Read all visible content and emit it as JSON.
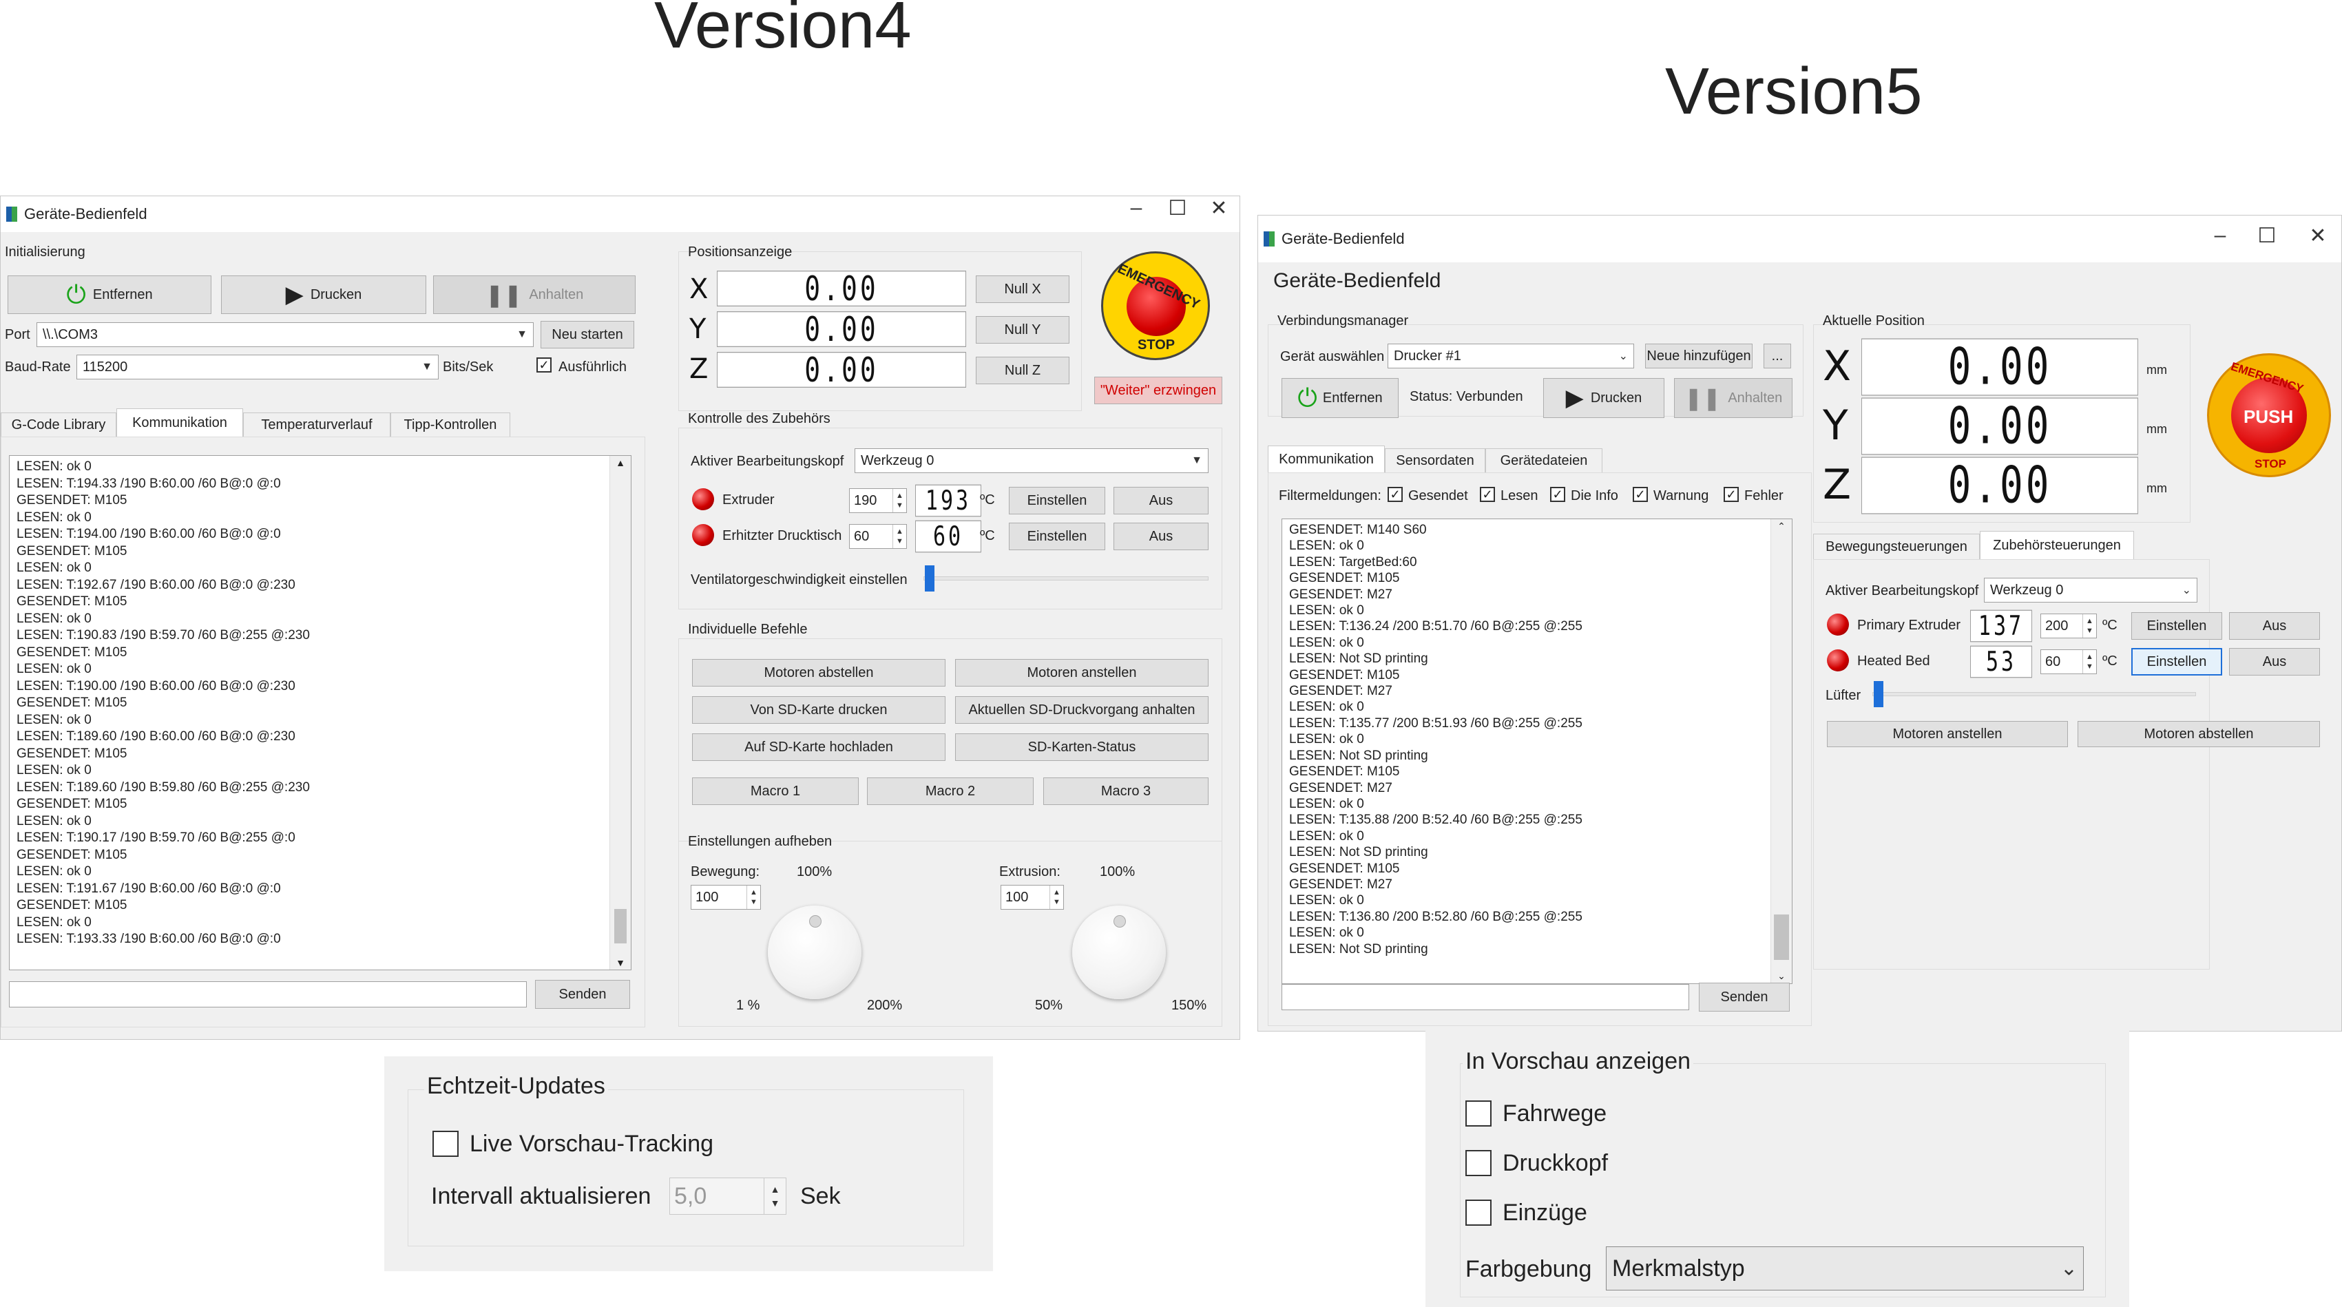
{
  "headings": {
    "v4": "Version4",
    "v5": "Version5"
  },
  "v4": {
    "title": "Geräte-Bedienfeld",
    "init": {
      "label": "Initialisierung",
      "btn_remove": "Entfernen",
      "btn_print": "Drucken",
      "btn_pause": "Anhalten",
      "port_label": "Port",
      "port_value": "\\\\.\\COM3",
      "btn_restart": "Neu starten",
      "baud_label": "Baud-Rate",
      "baud_value": "115200",
      "baud_unit": "Bits/Sek",
      "verbose": "Ausführlich"
    },
    "tabs": [
      "G-Code Library",
      "Kommunikation",
      "Temperaturverlauf",
      "Tipp-Kontrollen"
    ],
    "log": [
      "LESEN: ok 0",
      "LESEN: T:194.33 /190 B:60.00 /60 B@:0 @:0",
      "GESENDET: M105",
      "LESEN: ok 0",
      "LESEN: T:194.00 /190 B:60.00 /60 B@:0 @:0",
      "GESENDET: M105",
      "LESEN: ok 0",
      "LESEN: T:192.67 /190 B:60.00 /60 B@:0 @:230",
      "GESENDET: M105",
      "LESEN: ok 0",
      "LESEN: T:190.83 /190 B:59.70 /60 B@:255 @:230",
      "GESENDET: M105",
      "LESEN: ok 0",
      "LESEN: T:190.00 /190 B:60.00 /60 B@:0 @:230",
      "GESENDET: M105",
      "LESEN: ok 0",
      "LESEN: T:189.60 /190 B:60.00 /60 B@:0 @:230",
      "GESENDET: M105",
      "LESEN: ok 0",
      "LESEN: T:189.60 /190 B:59.80 /60 B@:255 @:230",
      "GESENDET: M105",
      "LESEN: ok 0",
      "LESEN: T:190.17 /190 B:59.70 /60 B@:255 @:0",
      "GESENDET: M105",
      "LESEN: ok 0",
      "LESEN: T:191.67 /190 B:60.00 /60 B@:0 @:0",
      "GESENDET: M105",
      "LESEN: ok 0",
      "LESEN: T:193.33 /190 B:60.00 /60 B@:0 @:0"
    ],
    "send": "Senden",
    "pos": {
      "label": "Positionsanzeige",
      "x": "X",
      "y": "Y",
      "z": "Z",
      "xv": "0.00",
      "yv": "0.00",
      "zv": "0.00",
      "nullx": "Null X",
      "nully": "Null Y",
      "nullz": "Null Z"
    },
    "estop": {
      "top": "EMERGENCY",
      "bottom": "STOP",
      "force": "\"Weiter\" erzwingen"
    },
    "acc": {
      "label": "Kontrolle des Zubehörs",
      "head_label": "Aktiver Bearbeitungskopf",
      "head_value": "Werkzeug 0",
      "extruder": "Extruder",
      "ext_target": "190",
      "ext_actual": "193",
      "bed": "Erhitzter Drucktisch",
      "bed_target": "60",
      "bed_actual": "60",
      "unit": "ºC",
      "set": "Einstellen",
      "off": "Aus",
      "fan": "Ventilatorgeschwindigkeit einstellen"
    },
    "cmds": {
      "label": "Individuelle Befehle",
      "b1": "Motoren abstellen",
      "b2": "Motoren anstellen",
      "b3": "Von SD-Karte drucken",
      "b4": "Aktuellen SD-Druckvorgang anhalten",
      "b5": "Auf SD-Karte hochladen",
      "b6": "SD-Karten-Status",
      "m1": "Macro 1",
      "m2": "Macro 2",
      "m3": "Macro 3"
    },
    "override": {
      "label": "Einstellungen aufheben",
      "move": "Bewegung:",
      "move_pct": "100%",
      "move_val": "100",
      "move_min": "1 %",
      "move_max": "200%",
      "ext": "Extrusion:",
      "ext_pct": "100%",
      "ext_val": "100",
      "ext_min": "50%",
      "ext_max": "150%"
    }
  },
  "v5": {
    "title": "Geräte-Bedienfeld",
    "header": "Geräte-Bedienfeld",
    "conn": {
      "label": "Verbindungsmanager",
      "device_label": "Gerät auswählen",
      "device_value": "Drucker #1",
      "btn_add": "Neue hinzufügen",
      "btn_more": "...",
      "btn_remove": "Entfernen",
      "status": "Status: Verbunden",
      "btn_print": "Drucken",
      "btn_pause": "Anhalten"
    },
    "tabs": [
      "Kommunikation",
      "Sensordaten",
      "Gerätedateien"
    ],
    "filter": {
      "label": "Filtermeldungen:",
      "f1": "Gesendet",
      "f2": "Lesen",
      "f3": "Die Info",
      "f4": "Warnung",
      "f5": "Fehler"
    },
    "log": [
      "GESENDET: M140 S60",
      "LESEN: ok 0",
      "LESEN: TargetBed:60",
      "GESENDET: M105",
      "GESENDET: M27",
      "LESEN: ok 0",
      "LESEN: T:136.24 /200 B:51.70 /60 B@:255 @:255",
      "LESEN: ok 0",
      "LESEN: Not SD printing",
      "GESENDET: M105",
      "GESENDET: M27",
      "LESEN: ok 0",
      "LESEN: T:135.77 /200 B:51.93 /60 B@:255 @:255",
      "LESEN: ok 0",
      "LESEN: Not SD printing",
      "GESENDET: M105",
      "GESENDET: M27",
      "LESEN: ok 0",
      "LESEN: T:135.88 /200 B:52.40 /60 B@:255 @:255",
      "LESEN: ok 0",
      "LESEN: Not SD printing",
      "GESENDET: M105",
      "GESENDET: M27",
      "LESEN: ok 0",
      "LESEN: T:136.80 /200 B:52.80 /60 B@:255 @:255",
      "LESEN: ok 0",
      "LESEN: Not SD printing"
    ],
    "send": "Senden",
    "pos": {
      "label": "Aktuelle Position",
      "x": "X",
      "y": "Y",
      "z": "Z",
      "xv": "0.00",
      "yv": "0.00",
      "zv": "0.00",
      "unit": "mm"
    },
    "estop": {
      "top": "EMERGENCY",
      "center": "PUSH",
      "bottom": "STOP"
    },
    "ctabs": [
      "Bewegungsteuerungen",
      "Zubehörsteuerungen"
    ],
    "acc": {
      "head_label": "Aktiver Bearbeitungskopf",
      "head_value": "Werkzeug 0",
      "ext": "Primary Extruder",
      "ext_actual": "137",
      "ext_target": "200",
      "bed": "Heated Bed",
      "bed_actual": "53",
      "bed_target": "60",
      "unit": "ºC",
      "set": "Einstellen",
      "off": "Aus",
      "fan": "Lüfter",
      "m_on": "Motoren anstellen",
      "m_off": "Motoren abstellen"
    }
  },
  "echtzeit": {
    "label": "Echtzeit-Updates",
    "live": "Live Vorschau-Tracking",
    "interval_label": "Intervall aktualisieren",
    "interval_value": "5,0",
    "unit": "Sek"
  },
  "preview": {
    "label": "In Vorschau anzeigen",
    "c1": "Fahrwege",
    "c2": "Druckkopf",
    "c3": "Einzüge",
    "color_label": "Farbgebung",
    "color_value": "Merkmalstyp"
  }
}
